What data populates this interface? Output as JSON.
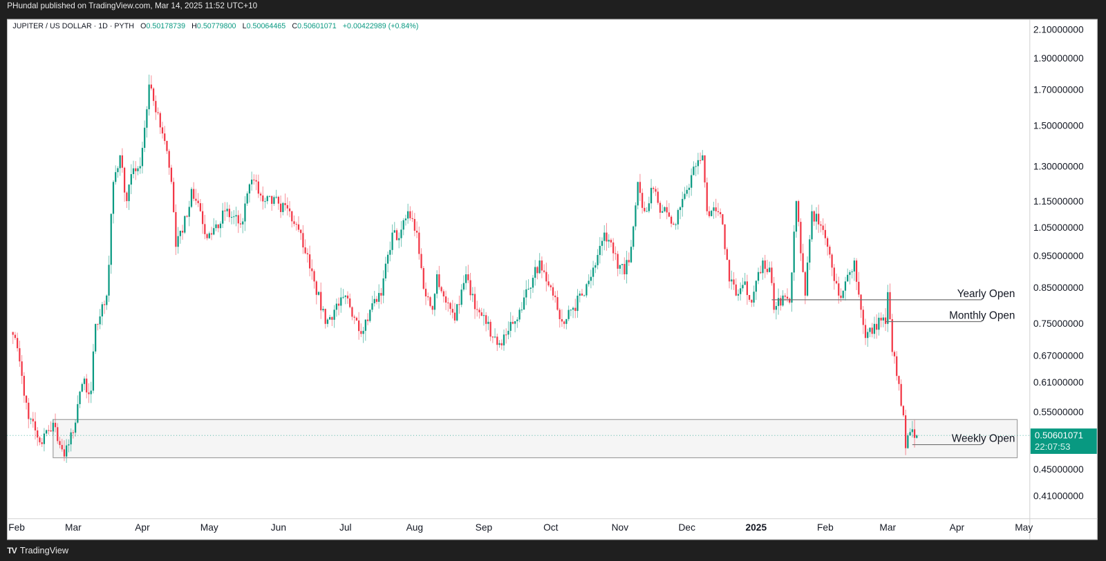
{
  "publish_note": "PHundal published on TradingView.com, Mar 14, 2025 11:52 UTC+10",
  "legend": {
    "symbol": "JUPITER / US DOLLAR · 1D · PYTH",
    "o_label": "O",
    "o": "0.50178739",
    "h_label": "H",
    "h": "0.50779800",
    "l_label": "L",
    "l": "0.50064465",
    "c_label": "C",
    "c": "0.50601071",
    "change": "+0.00422989 (+0.84%)"
  },
  "price_tag": {
    "price": "0.50601071",
    "countdown": "22:07:53"
  },
  "footer": {
    "logo_mark": "TV",
    "brand": "TradingView"
  },
  "colors": {
    "up": "#089981",
    "down": "#f23645",
    "zone_fill": "#f5f5f5",
    "zone_border": "#a0a0a0",
    "line": "#707070"
  },
  "chart_data": {
    "type": "candlestick",
    "title": "JUPITER / US DOLLAR",
    "interval": "1D",
    "source": "PYTH",
    "scale": "log",
    "ylim": [
      0.41,
      2.1
    ],
    "start_date": "2024-02-01",
    "y_ticks": [
      "2.10000000",
      "1.90000000",
      "1.70000000",
      "1.50000000",
      "1.30000000",
      "1.15000000",
      "1.05000000",
      "0.95000000",
      "0.85000000",
      "0.75000000",
      "0.67000000",
      "0.61000000",
      "0.55000000",
      "0.45000000",
      "0.41000000"
    ],
    "x_ticks": [
      {
        "label": "Feb",
        "day": 0
      },
      {
        "label": "Mar",
        "day": 29
      },
      {
        "label": "Apr",
        "day": 60
      },
      {
        "label": "May",
        "day": 90
      },
      {
        "label": "Jun",
        "day": 121
      },
      {
        "label": "Jul",
        "day": 151
      },
      {
        "label": "Aug",
        "day": 182
      },
      {
        "label": "Sep",
        "day": 213
      },
      {
        "label": "Oct",
        "day": 243
      },
      {
        "label": "Nov",
        "day": 274
      },
      {
        "label": "Dec",
        "day": 304
      },
      {
        "label": "2025",
        "day": 335,
        "bold": true
      },
      {
        "label": "Feb",
        "day": 366
      },
      {
        "label": "Mar",
        "day": 394
      },
      {
        "label": "Apr",
        "day": 425
      },
      {
        "label": "May",
        "day": 455
      }
    ],
    "close_path_day_price": [
      [
        2,
        0.72
      ],
      [
        3,
        0.712
      ],
      [
        9,
        0.536
      ],
      [
        15,
        0.491
      ],
      [
        20,
        0.529
      ],
      [
        25,
        0.47
      ],
      [
        29,
        0.511
      ],
      [
        33,
        0.606
      ],
      [
        37,
        0.592
      ],
      [
        39,
        0.748
      ],
      [
        44,
        0.826
      ],
      [
        47,
        1.23
      ],
      [
        50,
        1.35
      ],
      [
        53,
        1.15
      ],
      [
        56,
        1.29
      ],
      [
        59,
        1.3
      ],
      [
        63,
        1.73
      ],
      [
        66,
        1.57
      ],
      [
        70,
        1.42
      ],
      [
        73,
        1.23
      ],
      [
        75,
        0.98
      ],
      [
        78,
        1.03
      ],
      [
        82,
        1.2
      ],
      [
        86,
        1.11
      ],
      [
        89,
        1.01
      ],
      [
        93,
        1.06
      ],
      [
        97,
        1.11
      ],
      [
        104,
        1.06
      ],
      [
        109,
        1.24
      ],
      [
        115,
        1.15
      ],
      [
        121,
        1.14
      ],
      [
        126,
        1.11
      ],
      [
        129,
        1.06
      ],
      [
        133,
        0.958
      ],
      [
        137,
        0.868
      ],
      [
        142,
        0.748
      ],
      [
        146,
        0.786
      ],
      [
        151,
        0.826
      ],
      [
        156,
        0.757
      ],
      [
        159,
        0.73
      ],
      [
        162,
        0.786
      ],
      [
        167,
        0.826
      ],
      [
        172,
        1.03
      ],
      [
        175,
        1.01
      ],
      [
        179,
        1.11
      ],
      [
        183,
        1.03
      ],
      [
        186,
        0.846
      ],
      [
        190,
        0.786
      ],
      [
        192,
        0.89
      ],
      [
        196,
        0.806
      ],
      [
        200,
        0.757
      ],
      [
        205,
        0.89
      ],
      [
        210,
        0.786
      ],
      [
        214,
        0.748
      ],
      [
        219,
        0.695
      ],
      [
        224,
        0.73
      ],
      [
        229,
        0.786
      ],
      [
        233,
        0.846
      ],
      [
        238,
        0.934
      ],
      [
        241,
        0.868
      ],
      [
        246,
        0.786
      ],
      [
        249,
        0.748
      ],
      [
        252,
        0.786
      ],
      [
        257,
        0.826
      ],
      [
        262,
        0.911
      ],
      [
        267,
        1.03
      ],
      [
        271,
        0.958
      ],
      [
        276,
        0.89
      ],
      [
        279,
        0.98
      ],
      [
        282,
        1.23
      ],
      [
        285,
        1.11
      ],
      [
        289,
        1.2
      ],
      [
        293,
        1.11
      ],
      [
        299,
        1.06
      ],
      [
        303,
        1.18
      ],
      [
        308,
        1.3
      ],
      [
        311,
        1.35
      ],
      [
        313,
        1.11
      ],
      [
        317,
        1.11
      ],
      [
        320,
        1.06
      ],
      [
        323,
        0.868
      ],
      [
        326,
        0.826
      ],
      [
        330,
        0.868
      ],
      [
        333,
        0.806
      ],
      [
        338,
        0.934
      ],
      [
        341,
        0.911
      ],
      [
        343,
        0.786
      ],
      [
        347,
        0.826
      ],
      [
        350,
        0.806
      ],
      [
        353,
        1.15
      ],
      [
        355,
        0.958
      ],
      [
        357,
        0.826
      ],
      [
        360,
        1.11
      ],
      [
        363,
        1.06
      ],
      [
        366,
        1.01
      ],
      [
        369,
        0.911
      ],
      [
        372,
        0.826
      ],
      [
        375,
        0.868
      ],
      [
        379,
        0.934
      ],
      [
        382,
        0.786
      ],
      [
        384,
        0.712
      ],
      [
        388,
        0.748
      ],
      [
        391,
        0.757
      ],
      [
        393,
        0.748
      ],
      [
        394,
        0.836
      ],
      [
        396,
        0.678
      ],
      [
        399,
        0.606
      ],
      [
        401,
        0.543
      ],
      [
        402,
        0.484
      ],
      [
        404,
        0.512
      ],
      [
        406,
        0.50178739
      ]
    ],
    "last_candle": {
      "day": 407,
      "open": 0.50178739,
      "high": 0.507798,
      "low": 0.50064465,
      "close": 0.50601071
    },
    "current_price": 0.50601071,
    "zone": {
      "from_day": 20,
      "to_day": 452,
      "price_top": 0.535,
      "price_bottom": 0.468
    },
    "levels": [
      {
        "label": "Yearly Open",
        "price": 0.814,
        "from_day": 342,
        "to_day": 436
      },
      {
        "label": "Monthly Open",
        "price": 0.754,
        "from_day": 393,
        "to_day": 436
      },
      {
        "label": "Weekly Open",
        "price": 0.49,
        "from_day": 405,
        "to_day": 436
      }
    ]
  }
}
